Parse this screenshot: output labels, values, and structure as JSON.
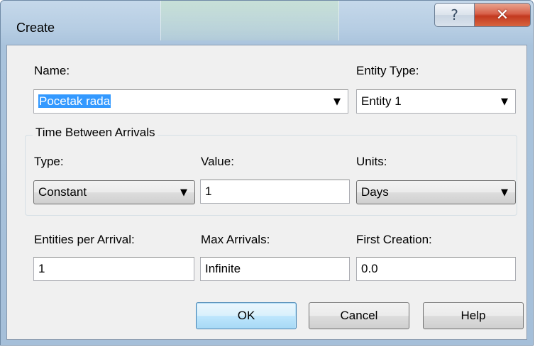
{
  "window": {
    "title": "Create",
    "help_glyph": "?",
    "close_glyph": "✕"
  },
  "fields": {
    "name_label": "Name:",
    "name_value": "Pocetak rada",
    "entity_type_label": "Entity Type:",
    "entity_type_value": "Entity 1",
    "group_title": "Time Between Arrivals",
    "type_label": "Type:",
    "type_value": "Constant",
    "value_label": "Value:",
    "value_value": "1",
    "units_label": "Units:",
    "units_value": "Days",
    "entities_per_arrival_label": "Entities per Arrival:",
    "entities_per_arrival_value": "1",
    "max_arrivals_label": "Max Arrivals:",
    "max_arrivals_value": "Infinite",
    "first_creation_label": "First Creation:",
    "first_creation_value": "0.0"
  },
  "buttons": {
    "ok": "OK",
    "cancel": "Cancel",
    "help": "Help"
  },
  "icons": {
    "dropdown_arrow": "▼"
  }
}
